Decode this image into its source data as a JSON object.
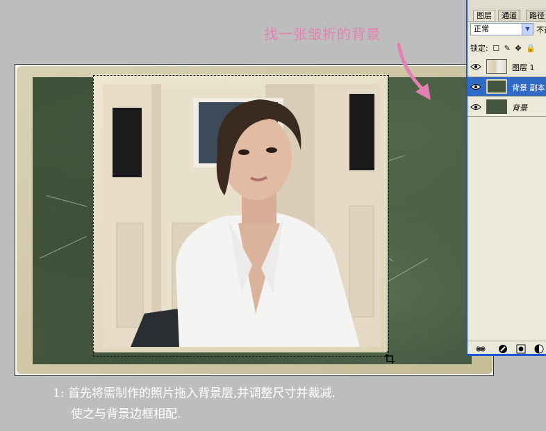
{
  "annotation": "找一张皱折的背景",
  "caption": {
    "line1": "1: 首先将需制作的照片拖入背景层,并调整尺寸并裁减.",
    "line2": "使之与背景边框相配."
  },
  "layers_panel": {
    "tabs": [
      "图层",
      "通道",
      "路径"
    ],
    "blend_mode": "正常",
    "opacity_label": "不透",
    "lock_label": "锁定:",
    "layers": [
      {
        "name": "图层 1",
        "selected": false
      },
      {
        "name": "背景 副本",
        "selected": true
      },
      {
        "name": "背景",
        "selected": false
      }
    ]
  },
  "colors": {
    "annotation": "#e47fb2",
    "selection_highlight": "#316ac5",
    "panel_border": "#1c56d6"
  }
}
